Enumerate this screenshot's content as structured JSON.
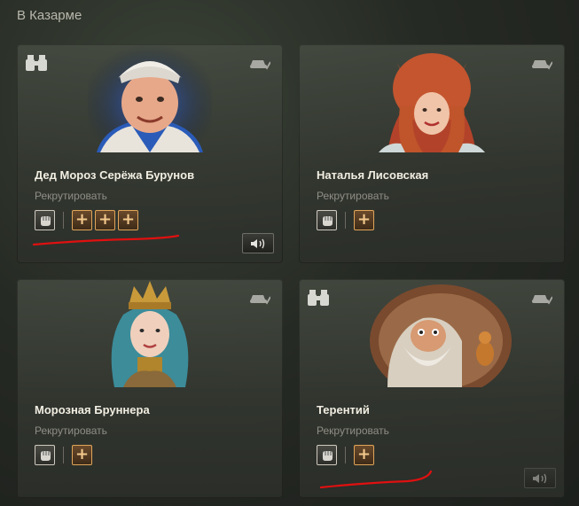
{
  "section": {
    "title": "В Казарме"
  },
  "cards": [
    {
      "name": "Дед Мороз Серёжа Бурунов",
      "action": "Рекрутировать",
      "skill_slots": [
        "+",
        "+",
        "+"
      ]
    },
    {
      "name": "Наталья Лисовская",
      "action": "Рекрутировать",
      "skill_slots": [
        "+"
      ]
    },
    {
      "name": "Морозная Бруннера",
      "action": "Рекрутировать",
      "skill_slots": [
        "+"
      ]
    },
    {
      "name": "Терентий",
      "action": "Рекрутировать",
      "skill_slots": [
        "+"
      ]
    }
  ],
  "icons": {
    "binoculars": "binoculars-icon",
    "crew": "crew-tank-icon",
    "base_skill": "fist-icon",
    "sound": "speaker-icon"
  },
  "colors": {
    "accent_skill": "#e0a55a",
    "annotation": "#e01010"
  }
}
